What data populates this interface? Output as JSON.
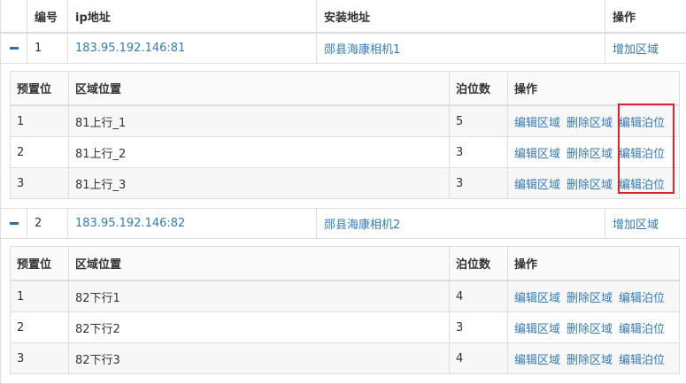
{
  "table": {
    "headers": {
      "no": "编号",
      "ip": "ip地址",
      "location": "安装地址",
      "actions": "操作"
    },
    "rows": [
      {
        "no": "1",
        "ip": "183.95.192.146:81",
        "location": "郧县海康相机1",
        "action": "增加区域",
        "detail": {
          "headers": {
            "preset": "预置位",
            "area": "区域位置",
            "spots": "泊位数",
            "actions": "操作"
          },
          "rows": [
            {
              "preset": "1",
              "area": "81上行_1",
              "spots": "5",
              "edit_area": "编辑区域",
              "delete_area": "删除区域",
              "edit_spots": "编辑泊位"
            },
            {
              "preset": "2",
              "area": "81上行_2",
              "spots": "3",
              "edit_area": "编辑区域",
              "delete_area": "删除区域",
              "edit_spots": "编辑泊位"
            },
            {
              "preset": "3",
              "area": "81上行_3",
              "spots": "3",
              "edit_area": "编辑区域",
              "delete_area": "删除区域",
              "edit_spots": "编辑泊位"
            }
          ]
        }
      },
      {
        "no": "2",
        "ip": "183.95.192.146:82",
        "location": "郧县海康相机2",
        "action": "增加区域",
        "detail": {
          "headers": {
            "preset": "预置位",
            "area": "区域位置",
            "spots": "泊位数",
            "actions": "操作"
          },
          "rows": [
            {
              "preset": "1",
              "area": "82下行1",
              "spots": "4",
              "edit_area": "编辑区域",
              "delete_area": "删除区域",
              "edit_spots": "编辑泊位"
            },
            {
              "preset": "2",
              "area": "82下行2",
              "spots": "3",
              "edit_area": "编辑区域",
              "delete_area": "删除区域",
              "edit_spots": "编辑泊位"
            },
            {
              "preset": "3",
              "area": "82下行3",
              "spots": "4",
              "edit_area": "编辑区域",
              "delete_area": "删除区域",
              "edit_spots": "编辑泊位"
            }
          ]
        }
      }
    ]
  },
  "colors": {
    "link": "#337ab7",
    "toggle": "#2a6db0",
    "highlight": "#d9232d",
    "border": "#dddddd"
  }
}
